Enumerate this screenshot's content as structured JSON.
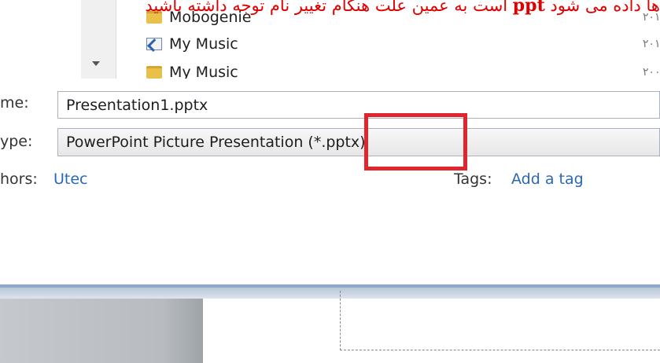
{
  "annotation": {
    "text_before": "ها داده می شود ",
    "bold_text": "ppt",
    "text_after": " است به عمین علت هنگام تغییر نام توجه داشته باشید"
  },
  "file_list": {
    "items": [
      {
        "name": "Mobogenie",
        "icon": "folder-icon",
        "date": "۲۰۱"
      },
      {
        "name": "My Music",
        "icon": "shortcut-icon",
        "date": "۲۰۱"
      },
      {
        "name": "My Music",
        "icon": "music-folder-icon",
        "date": "۲۰۰"
      }
    ]
  },
  "form": {
    "file_name_label": "me:",
    "file_name_value": "Presentation1.pptx",
    "save_type_label": "ype:",
    "save_type_value": "PowerPoint Picture Presentation (*.pptx)",
    "authors_label": "hors:",
    "authors_value": "Utec",
    "tags_label": "Tags:",
    "tags_value": "Add a tag"
  },
  "colors": {
    "annotation": "#e00000",
    "highlight_box": "#e0262c",
    "link": "#2a68b5"
  }
}
